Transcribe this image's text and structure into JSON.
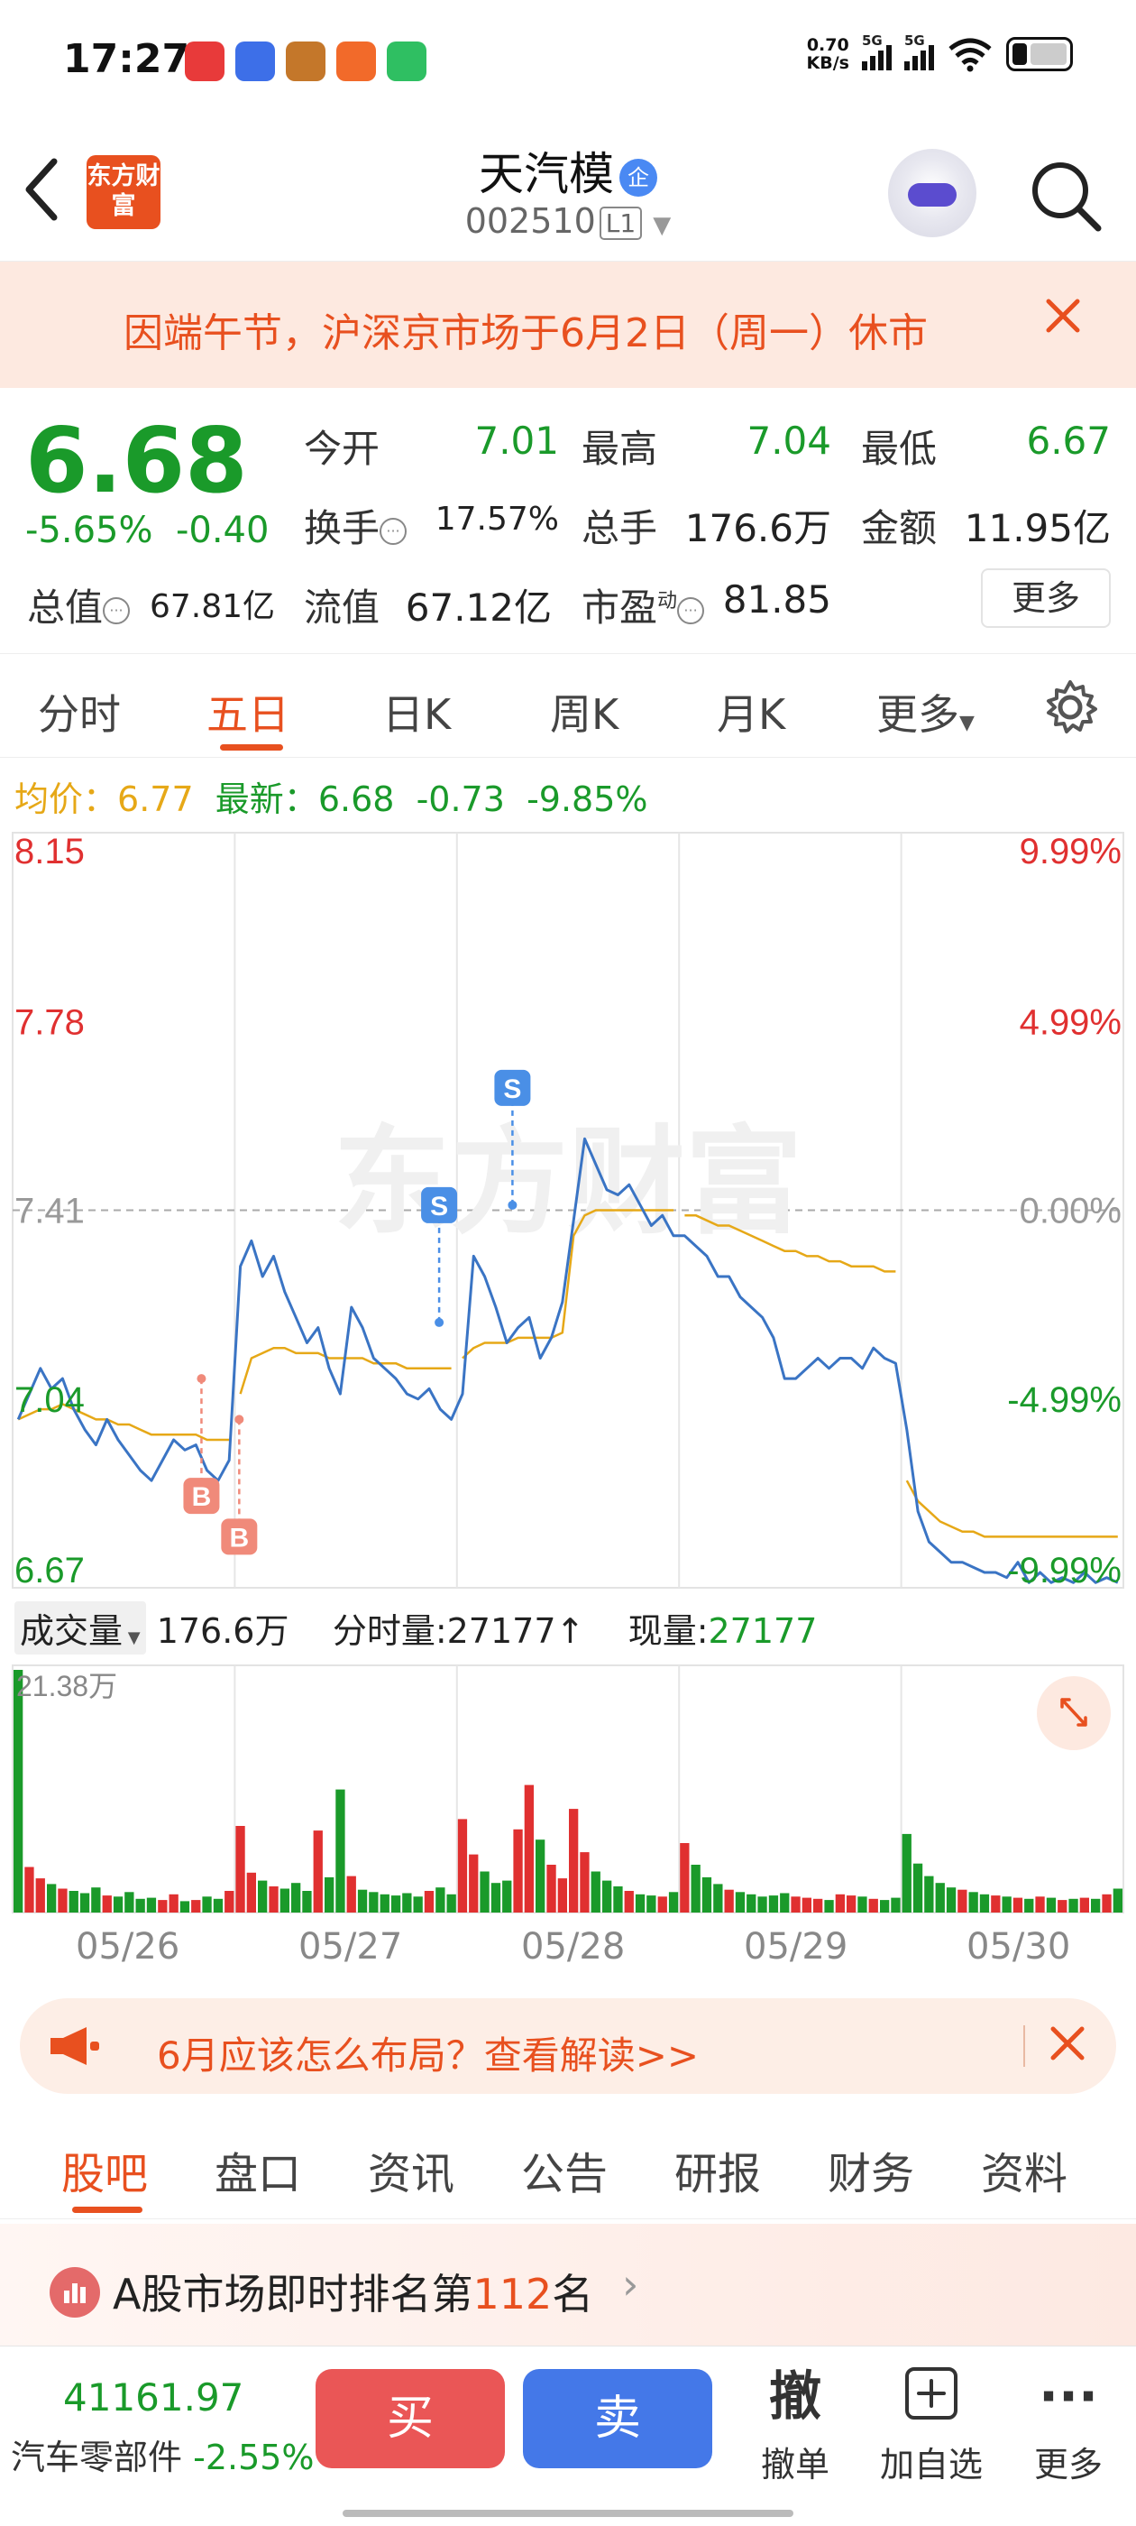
{
  "status_bar": {
    "time": "17:27",
    "net_speed_value": "0.70",
    "net_speed_unit": "KB/s",
    "signal_1": "5G",
    "signal_2": "5G"
  },
  "header": {
    "logo_text": "东方财富",
    "stock_name": "天汽模",
    "badge": "企",
    "stock_code": "002510",
    "level": "L1"
  },
  "notice": {
    "text": "因端午节，沪深京市场于6月2日（周一）休市"
  },
  "quote": {
    "price": "6.68",
    "change_pct": "-5.65%",
    "change_amt": "-0.40",
    "open_label": "今开",
    "open": "7.01",
    "high_label": "最高",
    "high": "7.04",
    "low_label": "最低",
    "low": "6.67",
    "turnover_label": "换手",
    "turnover": "17.57%",
    "volume_label": "总手",
    "volume": "176.6万",
    "amount_label": "金额",
    "amount": "11.95亿",
    "mktcap_label": "总值",
    "mktcap": "67.81亿",
    "float_label": "流值",
    "float_cap": "67.12亿",
    "pe_label": "市盈",
    "pe_sup": "动",
    "pe": "81.85",
    "more_label": "更多"
  },
  "chart_tabs": [
    "分时",
    "五日",
    "日K",
    "周K",
    "月K",
    "更多"
  ],
  "avg_line": {
    "avg_label": "均价：",
    "avg": "6.77",
    "latest_label": "最新：",
    "latest": "6.68",
    "chg": "-0.73",
    "chg_pct": "-9.85%"
  },
  "volume_info": {
    "label": "成交量",
    "total": "176.6万",
    "minute_label": "分时量:",
    "minute_vol": "27177",
    "now_label": "现量:",
    "now_vol": "27177"
  },
  "promo": {
    "text": "6月应该怎么布局？查看解读>>"
  },
  "info_tabs": [
    "股吧",
    "盘口",
    "资讯",
    "公告",
    "研报",
    "财务",
    "资料"
  ],
  "rank": {
    "prefix": "A股市场即时排名第",
    "rank": "112",
    "suffix": "名"
  },
  "bottom": {
    "index_value": "41161.97",
    "index_name": "汽车零部件",
    "index_chg": "-2.55%",
    "buy": "买",
    "sell": "卖",
    "cancel_glyph": "撤",
    "cancel_label": "撤单",
    "add_label": "加自选",
    "more_label": "更多"
  },
  "colors": {
    "accent": "#e8501f",
    "down": "#1a9a2a",
    "up": "#e03030",
    "price_line": "#3a74c4",
    "avg_line": "#e6a817"
  },
  "chart_data": {
    "type": "line",
    "title": "",
    "x_dates": [
      "05/26",
      "05/27",
      "05/28",
      "05/29",
      "05/30"
    ],
    "ylim": [
      6.67,
      8.15
    ],
    "y_ticks_left": [
      "8.15",
      "7.78",
      "7.41",
      "7.04",
      "6.67"
    ],
    "y_ticks_right": [
      "9.99%",
      "4.99%",
      "0.00%",
      "-4.99%",
      "-9.99%"
    ],
    "prev_close": 7.41,
    "series": [
      {
        "name": "",
        "values": [
          7.0,
          7.05,
          7.1,
          7.06,
          7.08,
          7.02,
          6.98,
          6.95,
          7.0,
          6.96,
          6.93,
          6.9,
          6.88,
          6.92,
          6.96,
          6.94,
          6.95,
          6.9,
          6.88,
          6.92,
          7.3,
          7.35,
          7.28,
          7.32,
          7.25,
          7.2,
          7.15,
          7.18,
          7.1,
          7.05,
          7.22,
          7.18,
          7.12,
          7.1,
          7.08,
          7.05,
          7.04,
          7.06,
          7.02,
          7.0,
          7.05,
          7.32,
          7.28,
          7.22,
          7.15,
          7.18,
          7.2,
          7.12,
          7.16,
          7.23,
          7.39,
          7.55,
          7.5,
          7.45,
          7.44,
          7.46,
          7.42,
          7.38,
          7.4,
          7.36,
          7.36,
          7.34,
          7.32,
          7.28,
          7.28,
          7.24,
          7.22,
          7.2,
          7.16,
          7.08,
          7.08,
          7.1,
          7.12,
          7.1,
          7.12,
          7.12,
          7.1,
          7.14,
          7.12,
          7.11,
          6.98,
          6.82,
          6.76,
          6.74,
          6.72,
          6.72,
          6.71,
          6.7,
          6.7,
          6.69,
          6.72,
          6.68,
          6.7,
          6.68,
          6.69,
          6.68,
          6.7,
          6.68,
          6.69,
          6.68
        ]
      },
      {
        "name": "均价",
        "values": [
          7.0,
          7.01,
          7.02,
          7.02,
          7.03,
          7.02,
          7.01,
          7.0,
          7.0,
          6.99,
          6.99,
          6.98,
          6.97,
          6.97,
          6.97,
          6.97,
          6.97,
          6.96,
          6.96,
          6.96,
          7.05,
          7.12,
          7.13,
          7.14,
          7.14,
          7.13,
          7.13,
          7.13,
          7.12,
          7.12,
          7.12,
          7.12,
          7.11,
          7.11,
          7.11,
          7.1,
          7.1,
          7.1,
          7.1,
          7.1,
          7.12,
          7.14,
          7.15,
          7.15,
          7.15,
          7.16,
          7.16,
          7.16,
          7.16,
          7.17,
          7.36,
          7.4,
          7.41,
          7.41,
          7.41,
          7.41,
          7.41,
          7.41,
          7.41,
          7.41,
          7.4,
          7.4,
          7.39,
          7.38,
          7.38,
          7.37,
          7.36,
          7.35,
          7.34,
          7.33,
          7.33,
          7.32,
          7.32,
          7.31,
          7.31,
          7.3,
          7.3,
          7.3,
          7.29,
          7.29,
          6.88,
          6.84,
          6.82,
          6.8,
          6.79,
          6.78,
          6.78,
          6.77,
          6.77,
          6.77,
          6.77,
          6.77,
          6.77,
          6.77,
          6.77,
          6.77,
          6.77,
          6.77,
          6.77,
          6.77
        ]
      }
    ],
    "markers": [
      {
        "label": "B",
        "day": 0,
        "pos": 0.85,
        "price": 7.08
      },
      {
        "label": "B",
        "day": 1,
        "pos": 0.02,
        "price": 7.0
      },
      {
        "label": "S",
        "day": 1,
        "pos": 0.92,
        "price": 7.19
      },
      {
        "label": "S",
        "day": 2,
        "pos": 0.25,
        "price": 7.42
      }
    ],
    "volume": {
      "max_label": "21.38万",
      "max": 21.38,
      "values": [
        21.3,
        4,
        3,
        2.5,
        2.1,
        1.9,
        1.7,
        2.2,
        1.5,
        1.4,
        1.8,
        1.2,
        1.3,
        1.1,
        1.6,
        1.0,
        1.1,
        1.4,
        1.2,
        1.9,
        7.6,
        3.5,
        2.8,
        2.3,
        2.1,
        2.6,
        1.9,
        7.2,
        3.1,
        10.8,
        3.2,
        2.0,
        1.8,
        1.6,
        1.5,
        1.7,
        1.4,
        1.9,
        2.2,
        1.6,
        8.2,
        5.1,
        3.6,
        2.6,
        2.8,
        7.3,
        11.2,
        6.4,
        4.2,
        3.0,
        9.1,
        5.3,
        3.6,
        2.8,
        2.3,
        1.9,
        1.6,
        1.5,
        1.4,
        1.8,
        6.1,
        4.2,
        3.1,
        2.5,
        2.0,
        1.8,
        1.6,
        1.4,
        1.5,
        1.7,
        1.4,
        1.3,
        1.2,
        1.1,
        1.6,
        1.5,
        1.4,
        1.2,
        1.1,
        1.3,
        6.9,
        4.3,
        3.2,
        2.6,
        2.2,
        2.0,
        1.8,
        1.6,
        1.5,
        1.4,
        1.3,
        1.2,
        1.4,
        1.3,
        1.1,
        1.2,
        1.3,
        1.2,
        1.6,
        2.1
      ]
    }
  }
}
